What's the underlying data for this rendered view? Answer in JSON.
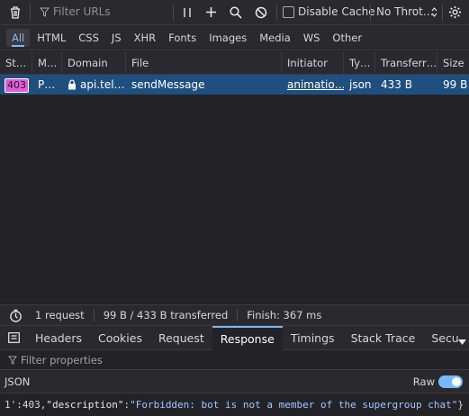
{
  "toolbar": {
    "filter_placeholder": "Filter URLs",
    "pause_icon": "pause-icon",
    "disable_cache_label": "Disable Cache",
    "throttle_value": "No Throt…"
  },
  "type_tabs": [
    "All",
    "HTML",
    "CSS",
    "JS",
    "XHR",
    "Fonts",
    "Images",
    "Media",
    "WS",
    "Other"
  ],
  "columns": [
    "St…",
    "M…",
    "Domain",
    "File",
    "Initiator",
    "Ty…",
    "Transferr…",
    "Size"
  ],
  "request": {
    "status": "403",
    "method": "P…",
    "domain": "api.tel…",
    "file": "sendMessage",
    "initiator": "animatio…",
    "type": "json",
    "transferred": "433 B",
    "size": "99 B"
  },
  "summary": {
    "requests": "1 request",
    "transferred": "99 B / 433 B transferred",
    "finish": "Finish: 367 ms"
  },
  "detail_tabs": [
    "Headers",
    "Cookies",
    "Request",
    "Response",
    "Timings",
    "Stack Trace",
    "Secu"
  ],
  "detail_active": "Response",
  "filter_properties": "Filter properties",
  "json_label": "JSON",
  "raw_label": "Raw",
  "raw_response": {
    "prefix": "1':403,",
    "key": "\"description\"",
    "colon": ":",
    "value": "\"Forbidden: bot is not a member of the supergroup chat\"",
    "suffix": "}"
  },
  "colors": {
    "accent": "#75baff",
    "selected_row": "#1f4f7f",
    "status_403": "#e15dd6"
  }
}
